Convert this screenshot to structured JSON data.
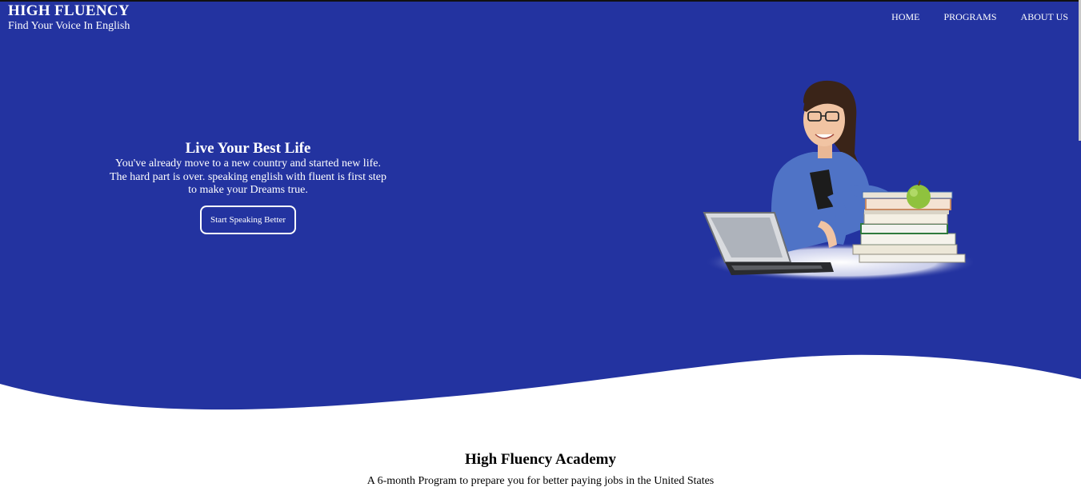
{
  "brand": {
    "title": "HIGH FLUENCY",
    "tagline": "Find Your Voice In English"
  },
  "nav": {
    "items": [
      "HOME",
      "PROGRAMS",
      "ABOUT US"
    ]
  },
  "hero": {
    "title": "Live Your Best Life",
    "lines": [
      "You've already move to a new country and started new life.",
      "The hard part is over. speaking english with fluent is first step",
      "to make your Dreams true."
    ],
    "button_label": "Start Speaking Better",
    "illustration": "woman-with-laptop-books-apple"
  },
  "academy": {
    "title": "High Fluency Academy",
    "subtitle": "A 6-month Program to prepare you for better paying jobs in the United States"
  },
  "colors": {
    "hero_bg": "#2333a0",
    "text_on_hero": "#ffffff",
    "body_bg": "#ffffff"
  }
}
